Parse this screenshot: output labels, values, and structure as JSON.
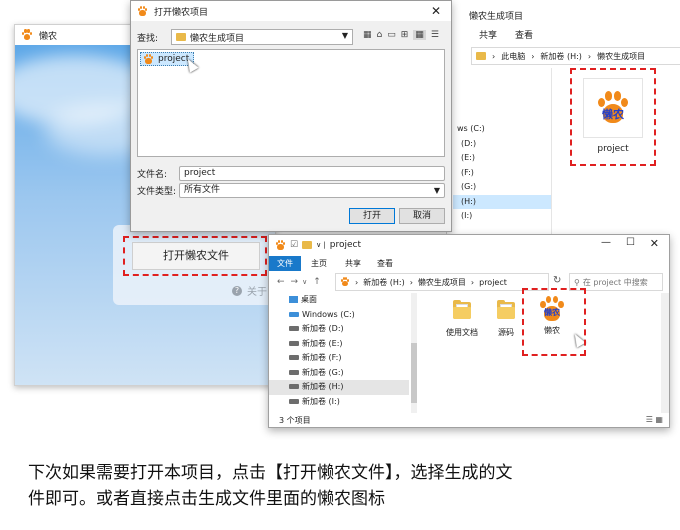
{
  "app": {
    "title": "懒农",
    "about": "关于",
    "main_button": "打开懒农文件"
  },
  "dialog": {
    "title": "打开懒农项目",
    "lookin_label": "查找:",
    "lookin_value": "懒农生成项目",
    "item": "project",
    "filename_label": "文件名:",
    "filename_value": "project",
    "filetype_label": "文件类型:",
    "filetype_value": "所有文件",
    "open_button": "打开",
    "cancel_button": "取消"
  },
  "explorer_back": {
    "title": "懒农生成项目",
    "tabs": [
      "共享",
      "查看"
    ],
    "path": [
      "此电脑",
      "新加卷 (H:)",
      "懒农生成项目"
    ],
    "drives": [
      "ws (C:)",
      "(D:)",
      "(E:)",
      "(F:)",
      "(G:)",
      "(H:)",
      "(I:)"
    ],
    "file_label": "project"
  },
  "explorer_front": {
    "title": "project",
    "tabs": [
      "文件",
      "主页",
      "共享",
      "查看"
    ],
    "path": [
      "新加卷 (H:)",
      "懒农生成项目",
      "project"
    ],
    "search_placeholder": "在 project 中搜索",
    "nav": [
      "桌面",
      "Windows (C:)",
      "新加卷 (D:)",
      "新加卷 (E:)",
      "新加卷 (F:)",
      "新加卷 (G:)",
      "新加卷 (H:)",
      "新加卷 (I:)"
    ],
    "files": [
      "使用文档",
      "源码",
      "懒农"
    ],
    "status": "3 个项目"
  },
  "logo_text": "懒农",
  "caption": [
    "下次如果需要打开本项目，点击【打开懒农文件】，选择生成的文",
    "件即可。或者直接点击生成文件里面的懒农图标"
  ],
  "colors": {
    "accent": "#1979ca",
    "logo_orange": "#f18a1a",
    "logo_blue": "#2540c8",
    "highlight_red": "#e02020",
    "sky_blue": "#a8cdf0"
  }
}
